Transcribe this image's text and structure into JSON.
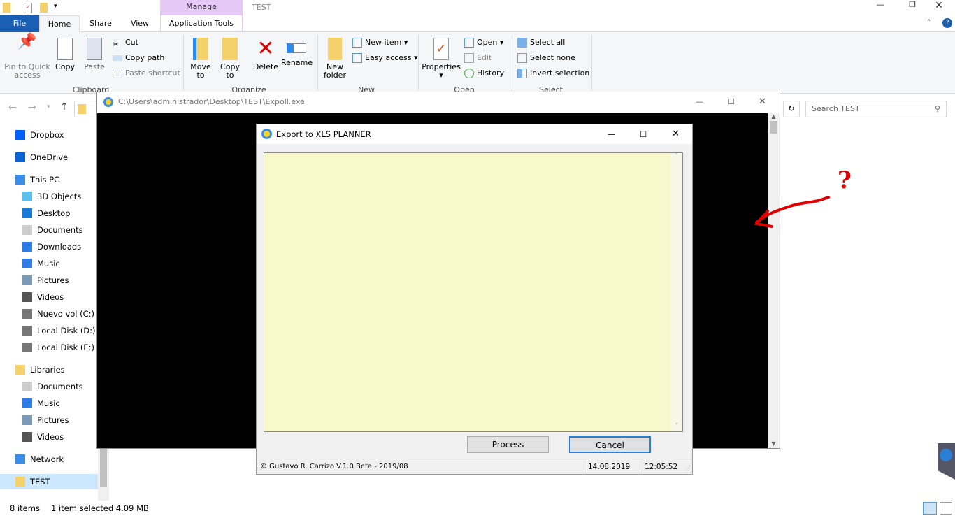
{
  "window": {
    "title": "TEST",
    "context_tab_group": "Manage"
  },
  "tabs": [
    "File",
    "Home",
    "Share",
    "View",
    "Application Tools"
  ],
  "ribbon": {
    "clipboard": {
      "label": "Clipboard",
      "pin": "Pin to Quick access",
      "copy": "Copy",
      "paste": "Paste",
      "cut": "Cut",
      "copy_path": "Copy path",
      "paste_shortcut": "Paste shortcut"
    },
    "organize": {
      "label": "Organize",
      "move_to": "Move to",
      "copy_to": "Copy to",
      "delete": "Delete",
      "rename": "Rename"
    },
    "new": {
      "label": "New",
      "new_folder": "New folder",
      "new_item": "New item",
      "easy_access": "Easy access"
    },
    "open": {
      "label": "Open",
      "properties": "Properties",
      "open": "Open",
      "edit": "Edit",
      "history": "History"
    },
    "select": {
      "label": "Select",
      "select_all": "Select all",
      "select_none": "Select none",
      "invert": "Invert selection"
    }
  },
  "search": {
    "placeholder": "Search TEST"
  },
  "nav": [
    {
      "label": "Dropbox",
      "icon": "dropbox-icon",
      "indent": 0
    },
    {
      "label": "OneDrive",
      "icon": "cloud-icon",
      "indent": 0
    },
    {
      "label": "This PC",
      "icon": "pc-icon",
      "indent": 0
    },
    {
      "label": "3D Objects",
      "icon": "cube-icon",
      "indent": 1
    },
    {
      "label": "Desktop",
      "icon": "desktop-icon",
      "indent": 1
    },
    {
      "label": "Documents",
      "icon": "document-icon",
      "indent": 1
    },
    {
      "label": "Downloads",
      "icon": "download-icon",
      "indent": 1
    },
    {
      "label": "Music",
      "icon": "music-icon",
      "indent": 1
    },
    {
      "label": "Pictures",
      "icon": "picture-icon",
      "indent": 1
    },
    {
      "label": "Videos",
      "icon": "video-icon",
      "indent": 1
    },
    {
      "label": "Nuevo vol (C:)",
      "icon": "drive-icon",
      "indent": 1
    },
    {
      "label": "Local Disk (D:)",
      "icon": "drive-icon",
      "indent": 1
    },
    {
      "label": "Local Disk (E:)",
      "icon": "drive-icon",
      "indent": 1
    },
    {
      "label": "Libraries",
      "icon": "library-icon",
      "indent": 0
    },
    {
      "label": "Documents",
      "icon": "document-icon",
      "indent": 1
    },
    {
      "label": "Music",
      "icon": "music-icon",
      "indent": 1
    },
    {
      "label": "Pictures",
      "icon": "picture-icon",
      "indent": 1
    },
    {
      "label": "Videos",
      "icon": "video-icon",
      "indent": 1
    },
    {
      "label": "Network",
      "icon": "network-icon",
      "indent": 0
    },
    {
      "label": "TEST",
      "icon": "folder-icon",
      "indent": 0
    }
  ],
  "status": {
    "items": "8 items",
    "selected": "1 item selected  4.09 MB"
  },
  "console": {
    "title": "C:\\Users\\administrador\\Desktop\\TEST\\Expoll.exe"
  },
  "dialog": {
    "title": "Export to XLS PLANNER",
    "process": "Process",
    "cancel": "Cancel",
    "copyright": "© Gustavo R. Carrizo V.1.0 Beta - 2019/08",
    "date": "14.08.2019",
    "time": "12:05:52"
  },
  "annotation": {
    "mark": "?"
  },
  "colors": {
    "file_tab": "#1a5fb4",
    "manage": "#e6c8f7",
    "textarea": "#f8f8cc",
    "annotation": "#e00000"
  }
}
